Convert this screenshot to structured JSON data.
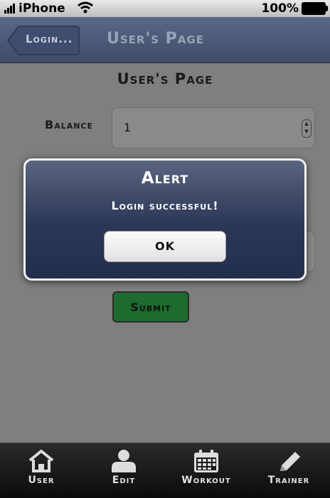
{
  "status_bar": {
    "carrier": "iPhone",
    "battery": "100%"
  },
  "header": {
    "back_label": "Login...",
    "title": "User's Page"
  },
  "page": {
    "title": "User's Page",
    "balance_label": "Balance",
    "balance_value": "1",
    "submit_label": "Submit"
  },
  "alert": {
    "title": "Alert",
    "message": "Login successful!",
    "ok_label": "OK"
  },
  "tabbar": {
    "items": [
      {
        "label": "User",
        "icon": "home-icon"
      },
      {
        "label": "Edit",
        "icon": "person-icon"
      },
      {
        "label": "Workout",
        "icon": "calendar-icon"
      },
      {
        "label": "Trainer",
        "icon": "pencil-icon"
      }
    ]
  }
}
